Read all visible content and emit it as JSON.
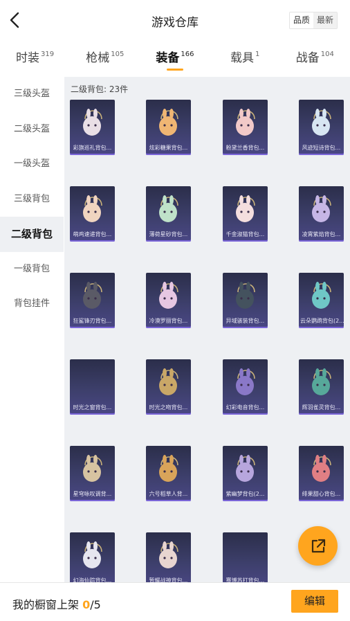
{
  "header": {
    "title": "游戏仓库",
    "sort_quality": "品质",
    "sort_newest": "最新"
  },
  "tabs": [
    {
      "label": "时装",
      "count": "319"
    },
    {
      "label": "枪械",
      "count": "105"
    },
    {
      "label": "装备",
      "count": "166"
    },
    {
      "label": "载具",
      "count": "1"
    },
    {
      "label": "战备",
      "count": "104"
    }
  ],
  "active_tab_index": 2,
  "sidebar": {
    "items": [
      {
        "label": "三级头盔"
      },
      {
        "label": "二级头盔"
      },
      {
        "label": "一级头盔"
      },
      {
        "label": "三级背包"
      },
      {
        "label": "二级背包"
      },
      {
        "label": "一级背包"
      },
      {
        "label": "背包挂件"
      }
    ],
    "active_index": 4
  },
  "section": {
    "title": "二级背包: 23件"
  },
  "items": [
    {
      "name": "彩旗巡礼背包...",
      "icon": "bunny-backpack",
      "color": "#e9dfe6"
    },
    {
      "name": "炫彩糖果背包...",
      "icon": "candy-backpack",
      "color": "#f0b673"
    },
    {
      "name": "粉黛兰香背包...",
      "icon": "flower-backpack",
      "color": "#f2c9c8"
    },
    {
      "name": "风迹短诗背包...",
      "icon": "poem-backpack",
      "color": "#d8e6f2"
    },
    {
      "name": "萌鸡速递背包...",
      "icon": "chick-backpack",
      "color": "#f0d4c0"
    },
    {
      "name": "薄荷星砂背包...",
      "icon": "mint-backpack",
      "color": "#bfe2c9"
    },
    {
      "name": "千金淑猫背包...",
      "icon": "cat-backpack",
      "color": "#f4dede"
    },
    {
      "name": "凌霄紫焰背包...",
      "icon": "purple-flame-backpack",
      "color": "#c6b6e6"
    },
    {
      "name": "狂鲨锋刃背包...",
      "icon": "shark-backpack",
      "color": "#5a5a66"
    },
    {
      "name": "冷漠罗丽背包...",
      "icon": "lolita-backpack",
      "color": "#e6c7e2"
    },
    {
      "name": "异域骇装背包...",
      "icon": "cyber-backpack",
      "color": "#44525e"
    },
    {
      "name": "云朵鹦鹉背包(2...",
      "icon": "parrot-backpack",
      "color": "#6fc7c6"
    },
    {
      "name": "时光之窗背包...",
      "icon": "time-window-backpack",
      "color": ""
    },
    {
      "name": "时光之吻背包...",
      "icon": "time-kiss-backpack",
      "color": "#c9a767"
    },
    {
      "name": "幻彩电音背包...",
      "icon": "music-backpack",
      "color": "#8a78c8"
    },
    {
      "name": "辉羽雀灵背包...",
      "icon": "feather-backpack",
      "color": "#57a89a"
    },
    {
      "name": "星穹咏叹调背...",
      "icon": "star-aria-backpack",
      "color": "#d7c3a1"
    },
    {
      "name": "六号稻草人背...",
      "icon": "scarecrow-backpack",
      "color": "#d9a45a"
    },
    {
      "name": "紫幽梦背包(2...",
      "icon": "dream-backpack",
      "color": "#b7a6dd"
    },
    {
      "name": "绯果甜心背包...",
      "icon": "berry-backpack",
      "color": "#e07f84"
    },
    {
      "name": "幻海仙踪背包...",
      "icon": "sea-backpack",
      "color": "#e6e6ef"
    },
    {
      "name": "暂耀战神背包...",
      "icon": "war-god-backpack",
      "color": "#e8d5d0"
    },
    {
      "name": "赛博苏打背包...",
      "icon": "soda-backpack",
      "color": ""
    }
  ],
  "fab": {
    "icon": "share-icon"
  },
  "bottom": {
    "label": "我的橱窗上架 ",
    "current": "0",
    "separator": "/",
    "max": "5",
    "edit_label": "编辑"
  }
}
